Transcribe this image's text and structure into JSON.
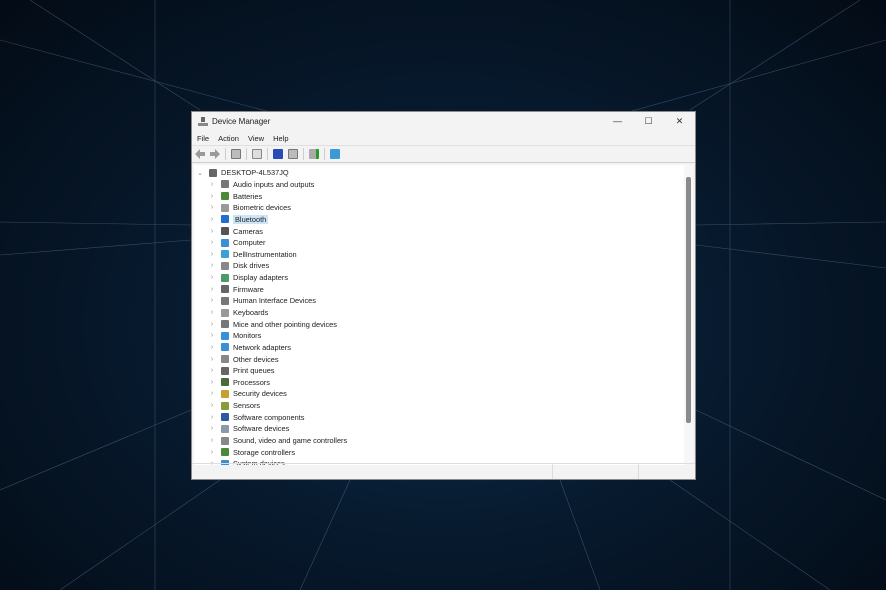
{
  "window": {
    "title": "Device Manager",
    "minimize": "—",
    "maximize": "☐",
    "close": "✕"
  },
  "menu": [
    "File",
    "Action",
    "View",
    "Help"
  ],
  "toolbar": [
    "back-icon",
    "forward-icon",
    "properties-icon",
    "update-driver-icon",
    "help-icon",
    "show-hidden-icon",
    "scan-hardware-icon",
    "monitor-icon"
  ],
  "tree": {
    "root": "DESKTOP-4L537JQ",
    "selected": "Bluetooth",
    "items": [
      {
        "label": "Audio inputs and outputs",
        "color": "#777"
      },
      {
        "label": "Batteries",
        "color": "#4a8a3a"
      },
      {
        "label": "Biometric devices",
        "color": "#999"
      },
      {
        "label": "Bluetooth",
        "color": "#1e6fd0"
      },
      {
        "label": "Cameras",
        "color": "#555"
      },
      {
        "label": "Computer",
        "color": "#3a8fd8"
      },
      {
        "label": "DellInstrumentation",
        "color": "#3aa0d8"
      },
      {
        "label": "Disk drives",
        "color": "#888"
      },
      {
        "label": "Display adapters",
        "color": "#4a9a6a"
      },
      {
        "label": "Firmware",
        "color": "#666"
      },
      {
        "label": "Human Interface Devices",
        "color": "#777"
      },
      {
        "label": "Keyboards",
        "color": "#999"
      },
      {
        "label": "Mice and other pointing devices",
        "color": "#777"
      },
      {
        "label": "Monitors",
        "color": "#3a8fd8"
      },
      {
        "label": "Network adapters",
        "color": "#3a8fd8"
      },
      {
        "label": "Other devices",
        "color": "#888"
      },
      {
        "label": "Print queues",
        "color": "#666"
      },
      {
        "label": "Processors",
        "color": "#4a6a3a"
      },
      {
        "label": "Security devices",
        "color": "#c8a030"
      },
      {
        "label": "Sensors",
        "color": "#8a9a3a"
      },
      {
        "label": "Software components",
        "color": "#2a5aa0"
      },
      {
        "label": "Software devices",
        "color": "#8a9aa8"
      },
      {
        "label": "Sound, video and game controllers",
        "color": "#888"
      },
      {
        "label": "Storage controllers",
        "color": "#4a8a3a"
      },
      {
        "label": "System devices",
        "color": "#3a8fd8"
      }
    ]
  }
}
